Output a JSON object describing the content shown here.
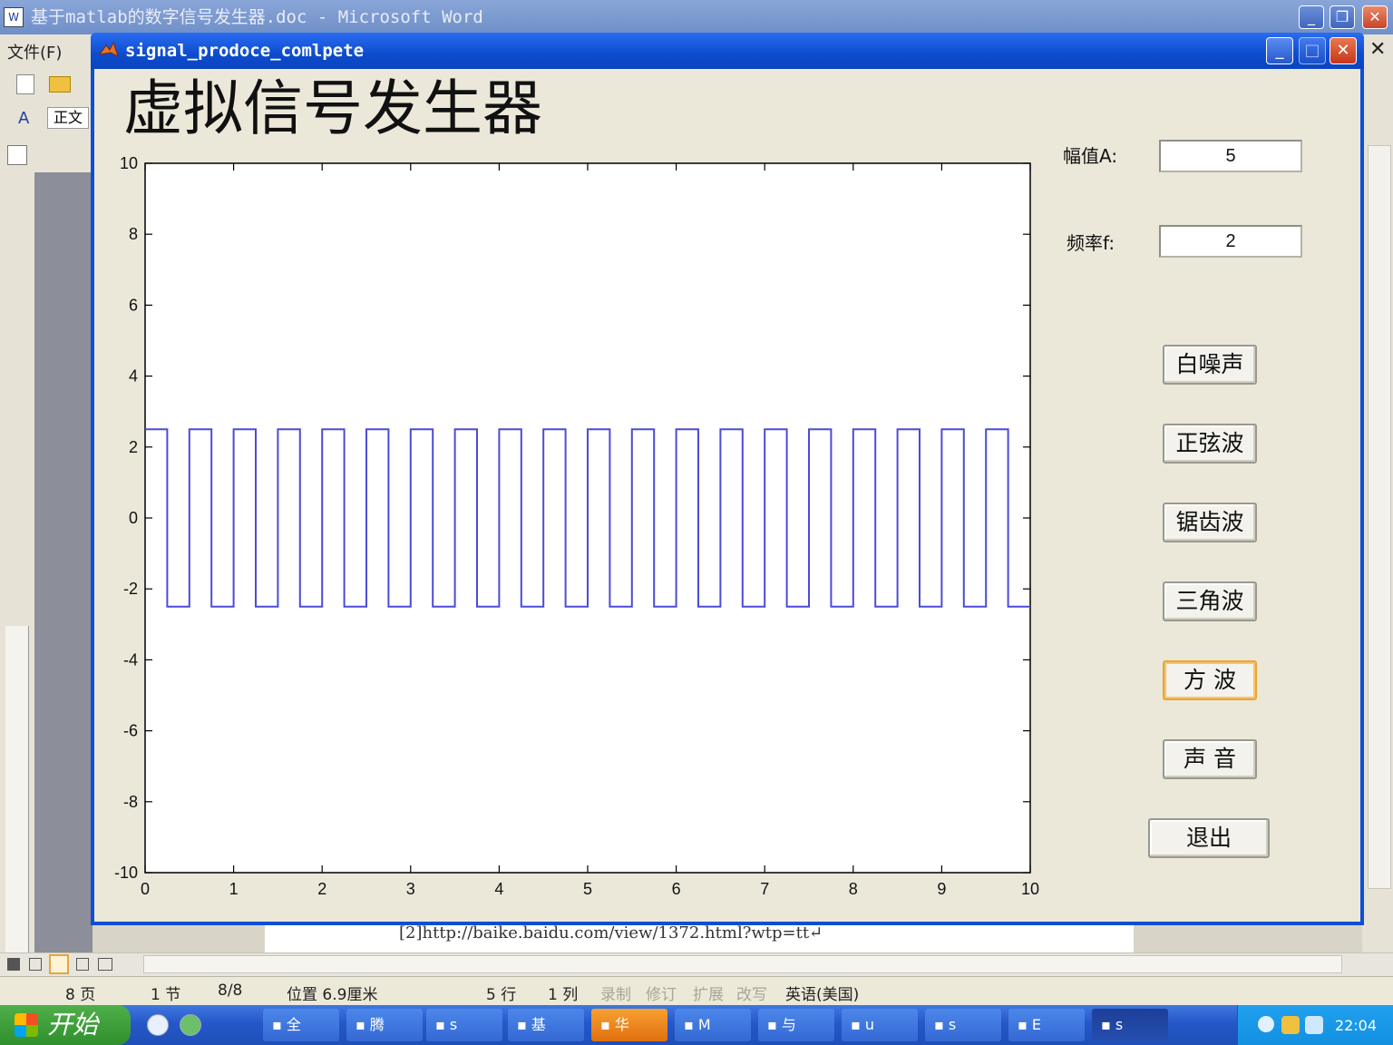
{
  "word": {
    "title": "基于matlab的数字信号发生器.doc - Microsoft Word",
    "menu_file": "文件(F)",
    "style_box": "正文",
    "doc_line": "[2]http://baike.baidu.com/view/1372.html?wtp=tt↵",
    "win_min": "_",
    "win_restore": "❐",
    "win_close": "✕"
  },
  "status": {
    "page": "8 页",
    "section": "1 节",
    "page_of": "8/8",
    "position": "位置 6.9厘米",
    "line": "5 行",
    "column": "1 列",
    "rec": "录制",
    "trk": "修订",
    "ext": "扩展",
    "ovr": "改写",
    "language": "英语(美国)"
  },
  "figure": {
    "title": "signal_prodoce_comlpete",
    "heading": "虚拟信号发生器",
    "amp_label": "幅值A:",
    "amp_value": "5",
    "freq_label": "频率f:",
    "freq_value": "2",
    "buttons": {
      "white_noise": "白噪声",
      "sine": "正弦波",
      "sawtooth": "锯齿波",
      "triangle": "三角波",
      "square": "方 波",
      "sound": "声 音",
      "exit": "退出"
    }
  },
  "taskbar": {
    "start": "开始",
    "items": [
      "全",
      "腾",
      "s",
      "基",
      "华",
      "M",
      "与",
      "u",
      "s",
      "E",
      "s"
    ],
    "clock": "22:04"
  },
  "colors": {
    "plot_line": "#4b4bd8",
    "xp_blue": "#0d4ccc",
    "figure_bg": "#ebe8da"
  },
  "chart_data": {
    "type": "line",
    "series": [
      {
        "waveform": "square",
        "amplitude": 2.5,
        "frequency": 2,
        "period": 0.5,
        "x_range": [
          0,
          10
        ]
      }
    ],
    "xlim": [
      0,
      10
    ],
    "ylim": [
      -10,
      10
    ],
    "x_ticks": [
      0,
      1,
      2,
      3,
      4,
      5,
      6,
      7,
      8,
      9,
      10
    ],
    "y_ticks": [
      -10,
      -8,
      -6,
      -4,
      -2,
      0,
      2,
      4,
      6,
      8,
      10
    ]
  }
}
